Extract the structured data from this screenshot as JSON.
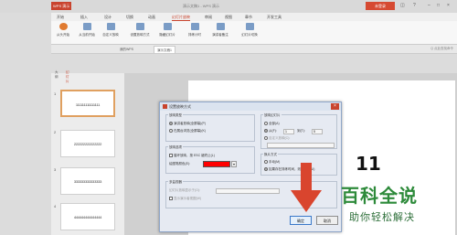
{
  "app": {
    "logo": "WPS 演示",
    "doc_title": "演示文稿1 - WPS 演示",
    "login": "未登录"
  },
  "menu": [
    "开始",
    "插入",
    "设计",
    "切换",
    "动画",
    "幻灯片放映",
    "审阅",
    "视图",
    "章节",
    "开发工具"
  ],
  "active_menu": "幻灯片放映",
  "ribbon": [
    {
      "label": "从头开始",
      "icon": "play-icon"
    },
    {
      "label": "从当前开始",
      "icon": "play-current-icon"
    },
    {
      "label": "自定义放映",
      "icon": "custom-show-icon"
    },
    {
      "label": "设置放映方式",
      "icon": "setup-show-icon"
    },
    {
      "label": "隐藏幻灯片",
      "icon": "hide-slide-icon"
    },
    {
      "label": "排练计时",
      "icon": "rehearse-icon"
    },
    {
      "label": "演讲者备注",
      "icon": "notes-icon"
    },
    {
      "label": "幻灯片切换",
      "icon": "transition-icon"
    }
  ],
  "doc_tabs": [
    {
      "label": "我的WPS"
    },
    {
      "label": "演示文稿1"
    }
  ],
  "tabs_right": "Q 点此查找命令",
  "sidebar": {
    "tabs": [
      "大纲",
      "幻灯片"
    ],
    "slides": [
      {
        "num": "1",
        "text": "111111111111111"
      },
      {
        "num": "2",
        "text": "222222222222222"
      },
      {
        "num": "3",
        "text": "333333333333333"
      },
      {
        "num": "4",
        "text": "444444444444444"
      }
    ]
  },
  "dialog": {
    "title": "设置放映方式",
    "show_type": {
      "title": "放映类型",
      "opt1": "演讲者放映(全屏幕)(P)",
      "opt2": "在展台浏览(全屏幕)(K)"
    },
    "show_options": {
      "title": "放映选项",
      "loop": "循环放映，按 ESC 键终止(L)",
      "pen_label": "绘图笔颜色(E):"
    },
    "show_slides": {
      "title": "放映幻灯片",
      "all": "全部(A)",
      "from": "从(F):",
      "from_val": "1",
      "to": "到(T):",
      "to_val": "5",
      "custom": "自定义放映(C):"
    },
    "advance": {
      "title": "换片方式",
      "manual": "手动(M)",
      "timing": "如果存在排练时间，则使用它(U)"
    },
    "multi_monitor": {
      "title": "多监视器",
      "monitor_label": "幻灯片放映显示于(O):",
      "presenter_view": "显示演示者视图(W)"
    },
    "ok": "确定",
    "cancel": "取消"
  },
  "overlay": {
    "step": "11",
    "brand": "百科全说",
    "tagline": "助你轻松解决"
  },
  "colors": {
    "accent": "#c9442e",
    "pen_color": "#ff0000",
    "arrow": "#d9452e",
    "brand": "#2d8a3a"
  }
}
